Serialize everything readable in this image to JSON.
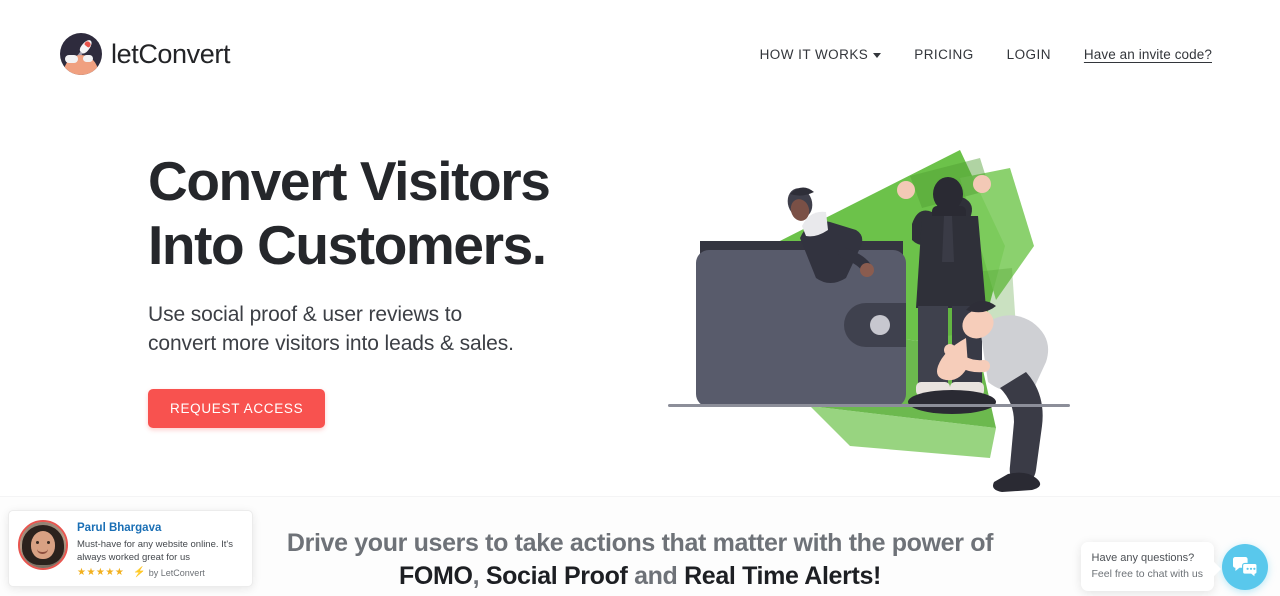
{
  "header": {
    "brand": {
      "name": "letConvert",
      "logo_icon": "rocket-planet-logo"
    },
    "nav": [
      {
        "label": "HOW IT WORKS",
        "has_caret": true
      },
      {
        "label": "PRICING",
        "has_caret": false
      },
      {
        "label": "LOGIN",
        "has_caret": false
      },
      {
        "label": "Have an invite code?",
        "has_caret": false
      }
    ]
  },
  "hero": {
    "headline_line1": "Convert Visitors",
    "headline_line2": "Into Customers.",
    "subhead_line1": "Use social proof & user reviews to",
    "subhead_line2": "convert more visitors into leads & sales.",
    "cta_label": "REQUEST ACCESS",
    "cta_color": "#f8524f",
    "illustration": "wallet-money-people-illustration"
  },
  "bottom_section": {
    "line1": "Drive your users to take actions that matter with the power of",
    "highlight1": "FOMO",
    "comma": ",",
    "highlight2": "Social Proof",
    "conjunction": " and ",
    "highlight3": "Real Time Alerts!"
  },
  "notification": {
    "name": "Parul Bhargava",
    "text": "Must-have for any website online. It's always worked great for us",
    "stars": "★★★★★",
    "rating": 5,
    "bolt_icon": "lightning-bolt-icon",
    "branding": "by LetConvert",
    "avatar_icon": "user-avatar-photo",
    "accent_color": "#e8554f",
    "name_color": "#1a6fb5",
    "star_color": "#f2b01e"
  },
  "chat_widget": {
    "line1": "Have any questions?",
    "line2": "Feel free to chat with us",
    "icon": "chat-bubbles-icon",
    "button_color": "#59c8ec"
  }
}
